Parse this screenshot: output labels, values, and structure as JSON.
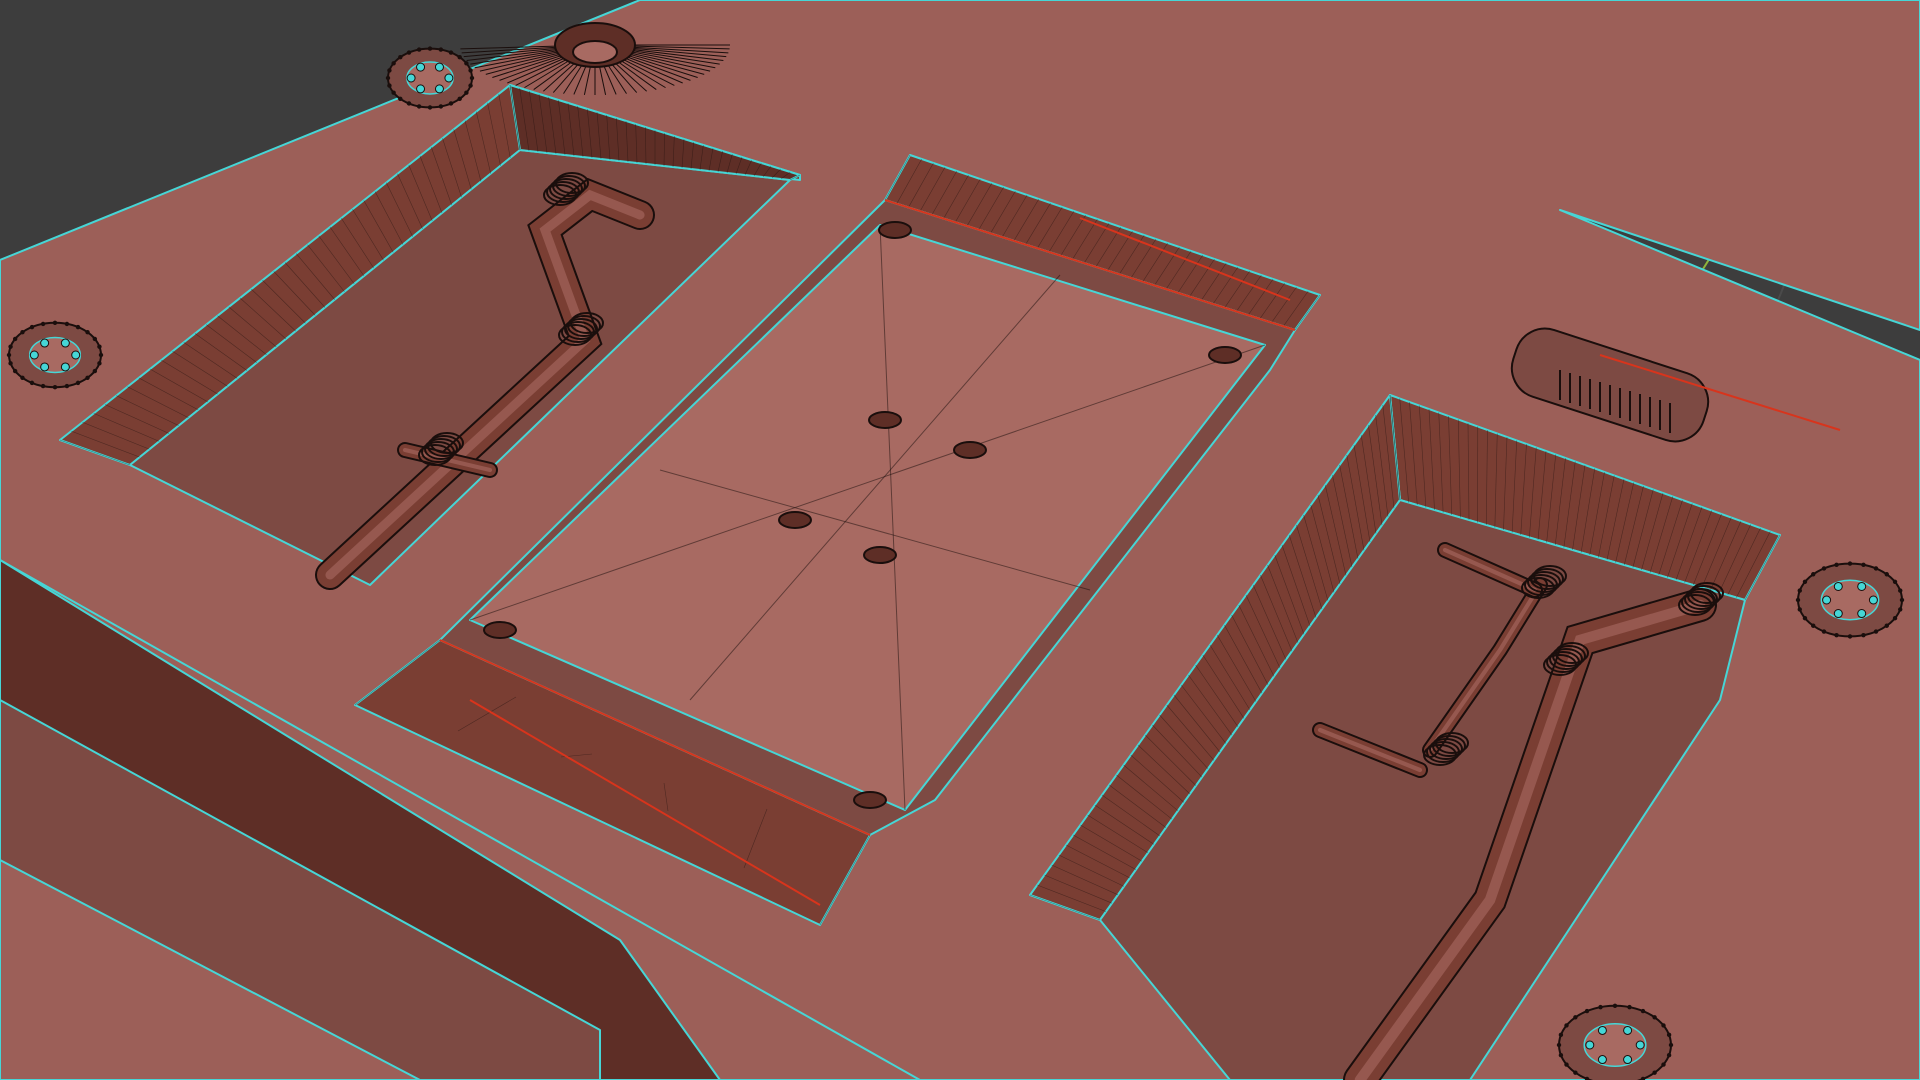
{
  "viewport": {
    "background": "#3d3d3d",
    "grid_color": "#4a4a4a",
    "axis_y_color": "#8fb43a"
  },
  "mesh": {
    "face_color": "#9c5f58",
    "face_light": "#a86a62",
    "face_dark": "#7d4a43",
    "wall_color": "#7a3e33",
    "wall_dark": "#5e2e26",
    "edge_selected": "#46d6d6",
    "edge_wire": "#1a0e0c",
    "edge_red": "#d8341c"
  },
  "objects": [
    {
      "name": "base-plate"
    },
    {
      "name": "left-recess"
    },
    {
      "name": "center-recess"
    },
    {
      "name": "right-recess"
    },
    {
      "name": "bolt-rings"
    },
    {
      "name": "pipes"
    }
  ]
}
